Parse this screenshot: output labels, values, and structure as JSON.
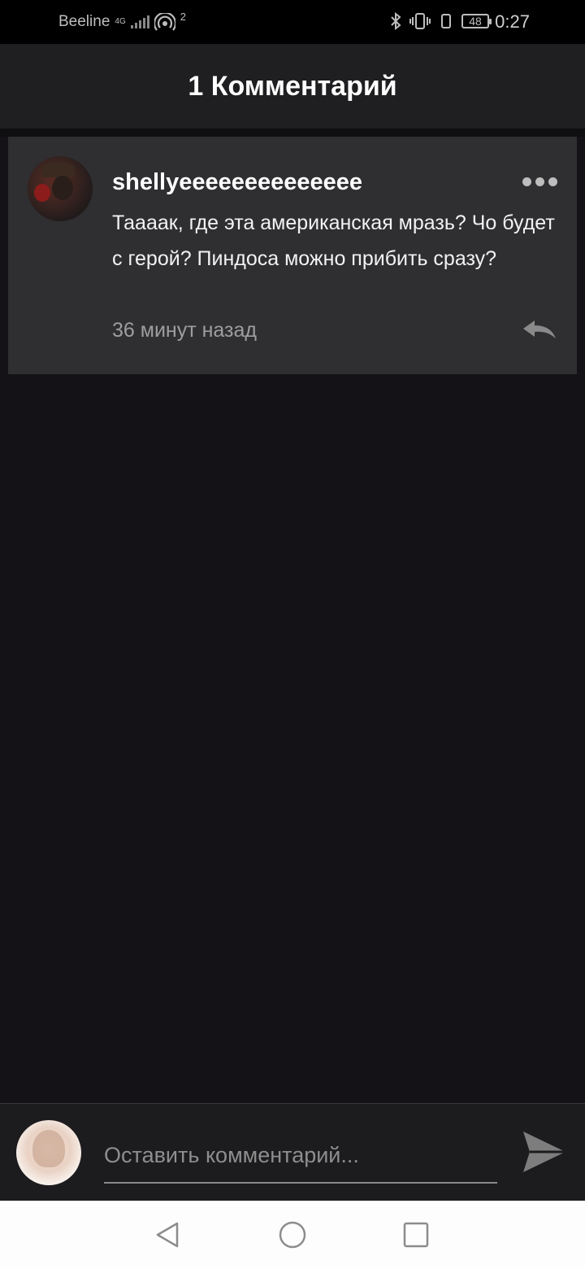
{
  "status_bar": {
    "carrier": "Beeline",
    "network": "4G",
    "hotspot_count": "2",
    "battery": "48",
    "time": "0:27"
  },
  "header": {
    "title": "1 Комментарий"
  },
  "comment": {
    "username": "shellyeeeeeeeeeeeeee",
    "text": "Тааaак, где эта американская мразь? Чо будет с герой? Пиндоса можно прибить сразу?",
    "time": "36 минут назад",
    "avatar_icon": "user-avatar",
    "more_icon": "more-dots-icon",
    "reply_icon": "reply-icon"
  },
  "input": {
    "placeholder": "Оставить комментарий...",
    "value": "",
    "send_icon": "send-icon"
  },
  "nav": {
    "back_icon": "back-triangle-icon",
    "home_icon": "home-circle-icon",
    "recents_icon": "recents-square-icon"
  },
  "colors": {
    "background": "#141216",
    "header": "#1f1e20",
    "card": "#2f2e31",
    "muted_text": "#9e9e9e"
  }
}
